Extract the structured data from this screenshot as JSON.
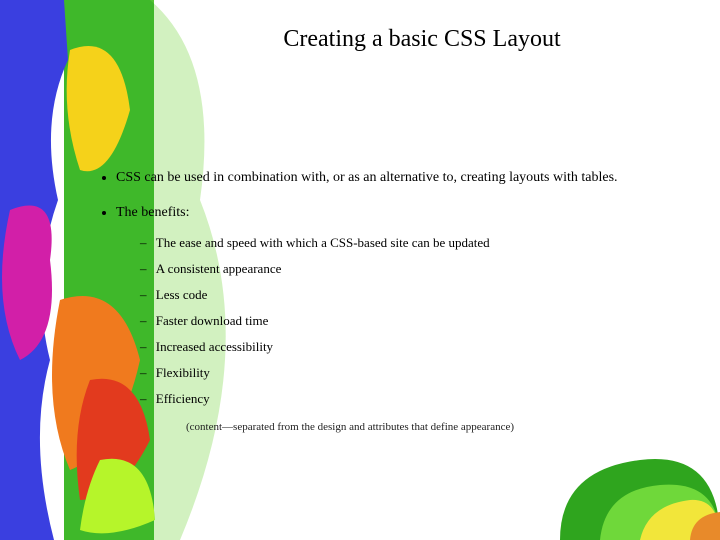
{
  "title": "Creating a basic CSS Layout",
  "bullets": {
    "b0": "CSS can be used in combination with, or as an alternative to, creating layouts with tables.",
    "b1": "The benefits:",
    "sub": [
      "The ease and speed with which a CSS-based site can be updated",
      "A consistent appearance",
      "Less code",
      "Faster download time",
      "Increased accessibility",
      "Flexibility",
      "Efficiency"
    ],
    "footnote": "(content—separated from the design and attributes that define appearance)"
  }
}
